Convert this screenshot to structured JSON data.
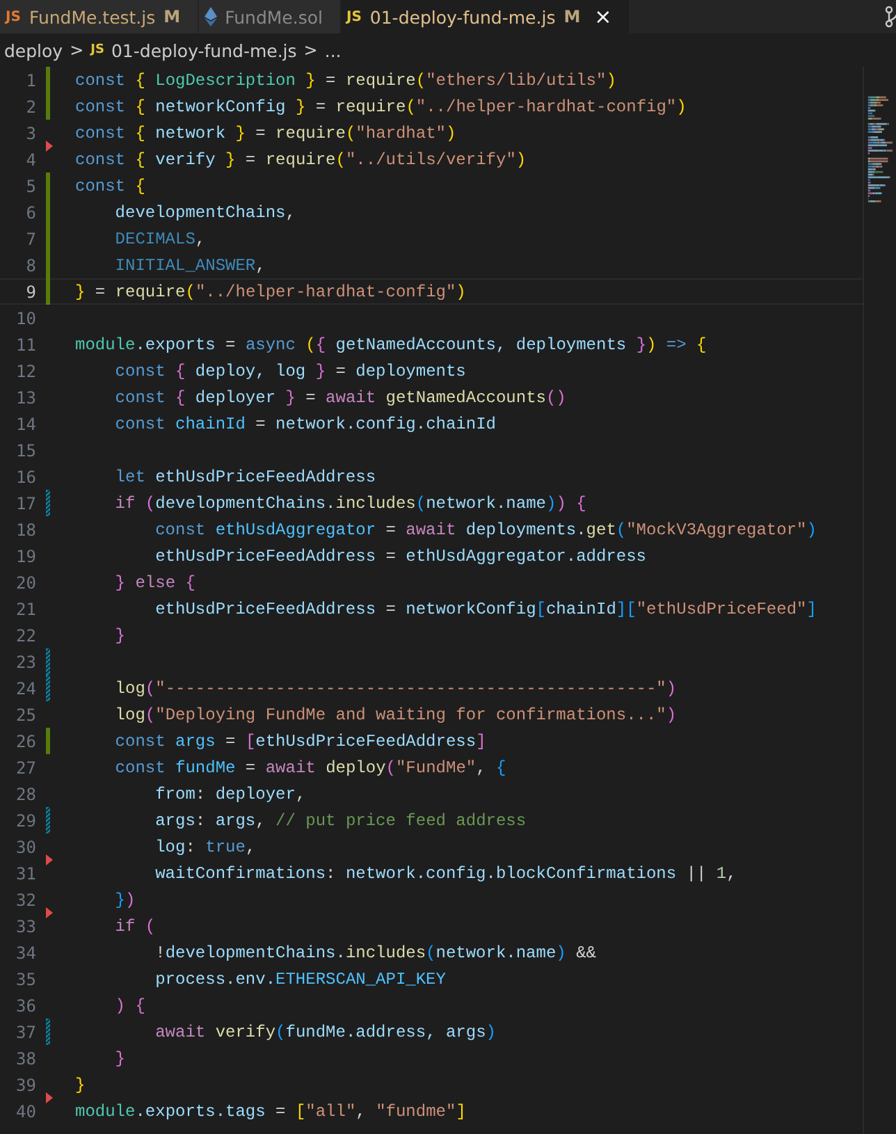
{
  "tabs": [
    {
      "label": "FundMe.test.js",
      "kind": "js",
      "icon_text": "JS",
      "badge": "M",
      "modified": true,
      "selected": false
    },
    {
      "label": "FundMe.sol",
      "kind": "sol",
      "modified": false,
      "selected": false
    },
    {
      "label": "01-deploy-fund-me.js",
      "kind": "js",
      "icon_text": "JS",
      "badge": "M",
      "modified": true,
      "selected": true,
      "close": "×"
    }
  ],
  "breadcrumb": {
    "folder": "deploy",
    "separator": ">",
    "file_badge": "JS",
    "file": "01-deploy-fund-me.js",
    "more": "..."
  },
  "lines": [
    {
      "n": "1",
      "gutter": {
        "kind": "added"
      },
      "current": false,
      "tokens": [
        {
          "text": "const ",
          "kind": "keyword"
        },
        {
          "text": "{",
          "kind": "bracket1"
        },
        {
          "text": " LogDescription ",
          "kind": "type"
        },
        {
          "text": "}",
          "kind": "bracket1"
        },
        {
          "text": " = ",
          "kind": "plain"
        },
        {
          "text": "require",
          "kind": "function"
        },
        {
          "text": "(",
          "kind": "bracket1"
        },
        {
          "text": "\"ethers/lib/utils\"",
          "kind": "string"
        },
        {
          "text": ")",
          "kind": "bracket1"
        }
      ]
    },
    {
      "n": "2",
      "gutter": {
        "kind": "added"
      },
      "current": false,
      "tokens": [
        {
          "text": "const ",
          "kind": "keyword"
        },
        {
          "text": "{",
          "kind": "bracket1"
        },
        {
          "text": " networkConfig ",
          "kind": "variable"
        },
        {
          "text": "}",
          "kind": "bracket1"
        },
        {
          "text": " = ",
          "kind": "plain"
        },
        {
          "text": "require",
          "kind": "function"
        },
        {
          "text": "(",
          "kind": "bracket1"
        },
        {
          "text": "\"../helper-hardhat-config\"",
          "kind": "string"
        },
        {
          "text": ")",
          "kind": "bracket1"
        }
      ]
    },
    {
      "n": "3",
      "current": false,
      "tokens": [
        {
          "text": "const ",
          "kind": "keyword"
        },
        {
          "text": "{",
          "kind": "bracket1"
        },
        {
          "text": " network ",
          "kind": "variable"
        },
        {
          "text": "}",
          "kind": "bracket1"
        },
        {
          "text": " = ",
          "kind": "plain"
        },
        {
          "text": "require",
          "kind": "function"
        },
        {
          "text": "(",
          "kind": "bracket1"
        },
        {
          "text": "\"hardhat\"",
          "kind": "string"
        },
        {
          "text": ")",
          "kind": "bracket1"
        }
      ]
    },
    {
      "n": "4",
      "gutter": {
        "kind": "deleted"
      },
      "current": false,
      "tokens": [
        {
          "text": "const ",
          "kind": "keyword"
        },
        {
          "text": "{",
          "kind": "bracket1"
        },
        {
          "text": " verify ",
          "kind": "variable"
        },
        {
          "text": "}",
          "kind": "bracket1"
        },
        {
          "text": " = ",
          "kind": "plain"
        },
        {
          "text": "require",
          "kind": "function"
        },
        {
          "text": "(",
          "kind": "bracket1"
        },
        {
          "text": "\"../utils/verify\"",
          "kind": "string"
        },
        {
          "text": ")",
          "kind": "bracket1"
        }
      ]
    },
    {
      "n": "5",
      "gutter": {
        "kind": "added"
      },
      "current": false,
      "tokens": [
        {
          "text": "const ",
          "kind": "keyword"
        },
        {
          "text": "{",
          "kind": "bracket1"
        }
      ]
    },
    {
      "n": "6",
      "gutter": {
        "kind": "added"
      },
      "current": false,
      "tokens": [
        {
          "text": "    developmentChains",
          "kind": "variable"
        },
        {
          "text": ",",
          "kind": "plain"
        }
      ]
    },
    {
      "n": "7",
      "gutter": {
        "kind": "added"
      },
      "current": false,
      "tokens": [
        {
          "text": "    DECIMALS",
          "kind": "dimconstant"
        },
        {
          "text": ",",
          "kind": "plain"
        }
      ]
    },
    {
      "n": "8",
      "gutter": {
        "kind": "added"
      },
      "current": false,
      "tokens": [
        {
          "text": "    INITIAL_ANSWER",
          "kind": "dimconstant"
        },
        {
          "text": ",",
          "kind": "plain"
        }
      ]
    },
    {
      "n": "9",
      "gutter": {
        "kind": "added"
      },
      "current": true,
      "tokens": [
        {
          "text": "}",
          "kind": "bracket1"
        },
        {
          "text": " = ",
          "kind": "plain"
        },
        {
          "text": "require",
          "kind": "function"
        },
        {
          "text": "(",
          "kind": "bracket1"
        },
        {
          "text": "\"../helper-hardhat-config\"",
          "kind": "string"
        },
        {
          "text": ")",
          "kind": "bracket1"
        }
      ]
    },
    {
      "n": "10",
      "current": false
    },
    {
      "n": "11",
      "current": false,
      "tokens": [
        {
          "text": "module",
          "kind": "type"
        },
        {
          "text": ".exports",
          "kind": "variable"
        },
        {
          "text": " = ",
          "kind": "plain"
        },
        {
          "text": "async ",
          "kind": "keyword"
        },
        {
          "text": "(",
          "kind": "bracket1"
        },
        {
          "text": "{",
          "kind": "bracket2"
        },
        {
          "text": " getNamedAccounts, deployments ",
          "kind": "variable"
        },
        {
          "text": "}",
          "kind": "bracket2"
        },
        {
          "text": ")",
          "kind": "bracket1"
        },
        {
          "text": " => ",
          "kind": "keyword"
        },
        {
          "text": "{",
          "kind": "bracket1"
        }
      ]
    },
    {
      "n": "12",
      "current": false,
      "tokens": [
        {
          "text": "    const ",
          "kind": "keyword"
        },
        {
          "text": "{",
          "kind": "bracket2"
        },
        {
          "text": " deploy, log ",
          "kind": "variable"
        },
        {
          "text": "}",
          "kind": "bracket2"
        },
        {
          "text": " = ",
          "kind": "plain"
        },
        {
          "text": "deployments",
          "kind": "variable"
        }
      ]
    },
    {
      "n": "13",
      "current": false,
      "tokens": [
        {
          "text": "    const ",
          "kind": "keyword"
        },
        {
          "text": "{",
          "kind": "bracket2"
        },
        {
          "text": " deployer ",
          "kind": "variable"
        },
        {
          "text": "}",
          "kind": "bracket2"
        },
        {
          "text": " = ",
          "kind": "plain"
        },
        {
          "text": "await ",
          "kind": "control"
        },
        {
          "text": "getNamedAccounts",
          "kind": "function"
        },
        {
          "text": "()",
          "kind": "bracket2"
        }
      ]
    },
    {
      "n": "14",
      "current": false,
      "tokens": [
        {
          "text": "    const ",
          "kind": "keyword"
        },
        {
          "text": "chainId",
          "kind": "constant"
        },
        {
          "text": " = ",
          "kind": "plain"
        },
        {
          "text": "network.config.chainId",
          "kind": "variable"
        }
      ]
    },
    {
      "n": "15",
      "current": false
    },
    {
      "n": "16",
      "current": false,
      "tokens": [
        {
          "text": "    let ",
          "kind": "keyword"
        },
        {
          "text": "ethUsdPriceFeedAddress",
          "kind": "variable"
        }
      ]
    },
    {
      "n": "17",
      "gutter": {
        "kind": "modified"
      },
      "current": false,
      "tokens": [
        {
          "text": "    if ",
          "kind": "control"
        },
        {
          "text": "(",
          "kind": "bracket2"
        },
        {
          "text": "developmentChains.",
          "kind": "variable"
        },
        {
          "text": "includes",
          "kind": "function"
        },
        {
          "text": "(",
          "kind": "bracket3"
        },
        {
          "text": "network.name",
          "kind": "variable"
        },
        {
          "text": ")",
          "kind": "bracket3"
        },
        {
          "text": ")",
          "kind": "bracket2"
        },
        {
          "text": " {",
          "kind": "bracket2"
        }
      ]
    },
    {
      "n": "18",
      "current": false,
      "tokens": [
        {
          "text": "        const ",
          "kind": "keyword"
        },
        {
          "text": "ethUsdAggregator",
          "kind": "constant"
        },
        {
          "text": " = ",
          "kind": "plain"
        },
        {
          "text": "await ",
          "kind": "control"
        },
        {
          "text": "deployments.",
          "kind": "variable"
        },
        {
          "text": "get",
          "kind": "function"
        },
        {
          "text": "(",
          "kind": "bracket3"
        },
        {
          "text": "\"MockV3Aggregator\"",
          "kind": "string"
        },
        {
          "text": ")",
          "kind": "bracket3"
        }
      ]
    },
    {
      "n": "19",
      "current": false,
      "tokens": [
        {
          "text": "        ethUsdPriceFeedAddress",
          "kind": "variable"
        },
        {
          "text": " = ",
          "kind": "plain"
        },
        {
          "text": "ethUsdAggregator.address",
          "kind": "variable"
        }
      ]
    },
    {
      "n": "20",
      "current": false,
      "tokens": [
        {
          "text": "    }",
          "kind": "bracket2"
        },
        {
          "text": " else ",
          "kind": "control"
        },
        {
          "text": "{",
          "kind": "bracket2"
        }
      ]
    },
    {
      "n": "21",
      "current": false,
      "tokens": [
        {
          "text": "        ethUsdPriceFeedAddress",
          "kind": "variable"
        },
        {
          "text": " = ",
          "kind": "plain"
        },
        {
          "text": "networkConfig",
          "kind": "variable"
        },
        {
          "text": "[",
          "kind": "bracket3"
        },
        {
          "text": "chainId",
          "kind": "variable"
        },
        {
          "text": "]",
          "kind": "bracket3"
        },
        {
          "text": "[",
          "kind": "bracket3"
        },
        {
          "text": "\"ethUsdPriceFeed\"",
          "kind": "string"
        },
        {
          "text": "]",
          "kind": "bracket3"
        }
      ]
    },
    {
      "n": "22",
      "current": false,
      "tokens": [
        {
          "text": "    }",
          "kind": "bracket2"
        }
      ]
    },
    {
      "n": "23",
      "gutter": {
        "kind": "modified"
      },
      "current": false
    },
    {
      "n": "24",
      "gutter": {
        "kind": "modified"
      },
      "current": false,
      "tokens": [
        {
          "text": "    log",
          "kind": "function"
        },
        {
          "text": "(",
          "kind": "bracket2"
        },
        {
          "text": "\"-------------------------------------------------\"",
          "kind": "string"
        },
        {
          "text": ")",
          "kind": "bracket2"
        }
      ]
    },
    {
      "n": "25",
      "current": false,
      "tokens": [
        {
          "text": "    log",
          "kind": "function"
        },
        {
          "text": "(",
          "kind": "bracket2"
        },
        {
          "text": "\"Deploying FundMe and waiting for confirmations...\"",
          "kind": "string"
        },
        {
          "text": ")",
          "kind": "bracket2"
        }
      ]
    },
    {
      "n": "26",
      "gutter": {
        "kind": "added"
      },
      "current": false,
      "tokens": [
        {
          "text": "    const ",
          "kind": "keyword"
        },
        {
          "text": "args",
          "kind": "constant"
        },
        {
          "text": " = ",
          "kind": "plain"
        },
        {
          "text": "[",
          "kind": "bracket2"
        },
        {
          "text": "ethUsdPriceFeedAddress",
          "kind": "variable"
        },
        {
          "text": "]",
          "kind": "bracket2"
        }
      ]
    },
    {
      "n": "27",
      "current": false,
      "tokens": [
        {
          "text": "    const ",
          "kind": "keyword"
        },
        {
          "text": "fundMe",
          "kind": "constant"
        },
        {
          "text": " = ",
          "kind": "plain"
        },
        {
          "text": "await ",
          "kind": "control"
        },
        {
          "text": "deploy",
          "kind": "function"
        },
        {
          "text": "(",
          "kind": "bracket2"
        },
        {
          "text": "\"FundMe\"",
          "kind": "string"
        },
        {
          "text": ", ",
          "kind": "plain"
        },
        {
          "text": "{",
          "kind": "bracket3"
        }
      ]
    },
    {
      "n": "28",
      "current": false,
      "tokens": [
        {
          "text": "        from",
          "kind": "variable"
        },
        {
          "text": ": ",
          "kind": "plain"
        },
        {
          "text": "deployer",
          "kind": "variable"
        },
        {
          "text": ",",
          "kind": "plain"
        }
      ]
    },
    {
      "n": "29",
      "gutter": {
        "kind": "modified"
      },
      "current": false,
      "tokens": [
        {
          "text": "        args",
          "kind": "variable"
        },
        {
          "text": ": ",
          "kind": "plain"
        },
        {
          "text": "args",
          "kind": "variable"
        },
        {
          "text": ", ",
          "kind": "plain"
        },
        {
          "text": "// put price feed address",
          "kind": "comment"
        }
      ]
    },
    {
      "n": "30",
      "current": false,
      "tokens": [
        {
          "text": "        log",
          "kind": "variable"
        },
        {
          "text": ": ",
          "kind": "plain"
        },
        {
          "text": "true",
          "kind": "keyword"
        },
        {
          "text": ",",
          "kind": "plain"
        }
      ]
    },
    {
      "n": "31",
      "gutter": {
        "kind": "deleted"
      },
      "current": false,
      "tokens": [
        {
          "text": "        waitConfirmations",
          "kind": "variable"
        },
        {
          "text": ": ",
          "kind": "plain"
        },
        {
          "text": "network.config.blockConfirmations",
          "kind": "variable"
        },
        {
          "text": " || ",
          "kind": "plain"
        },
        {
          "text": "1",
          "kind": "number"
        },
        {
          "text": ",",
          "kind": "plain"
        }
      ]
    },
    {
      "n": "32",
      "current": false,
      "tokens": [
        {
          "text": "    }",
          "kind": "bracket3"
        },
        {
          "text": ")",
          "kind": "bracket2"
        }
      ]
    },
    {
      "n": "33",
      "gutter": {
        "kind": "deleted"
      },
      "current": false,
      "tokens": [
        {
          "text": "    if ",
          "kind": "control"
        },
        {
          "text": "(",
          "kind": "bracket2"
        }
      ]
    },
    {
      "n": "34",
      "current": false,
      "tokens": [
        {
          "text": "        !",
          "kind": "plain"
        },
        {
          "text": "developmentChains.",
          "kind": "variable"
        },
        {
          "text": "includes",
          "kind": "function"
        },
        {
          "text": "(",
          "kind": "bracket3"
        },
        {
          "text": "network.name",
          "kind": "variable"
        },
        {
          "text": ")",
          "kind": "bracket3"
        },
        {
          "text": " &&",
          "kind": "plain"
        }
      ]
    },
    {
      "n": "35",
      "current": false,
      "tokens": [
        {
          "text": "        process.env.",
          "kind": "variable"
        },
        {
          "text": "ETHERSCAN_API_KEY",
          "kind": "constant"
        }
      ]
    },
    {
      "n": "36",
      "current": false,
      "tokens": [
        {
          "text": "    )",
          "kind": "bracket2"
        },
        {
          "text": " {",
          "kind": "bracket2"
        }
      ]
    },
    {
      "n": "37",
      "gutter": {
        "kind": "modified"
      },
      "current": false,
      "tokens": [
        {
          "text": "        await ",
          "kind": "control"
        },
        {
          "text": "verify",
          "kind": "function"
        },
        {
          "text": "(",
          "kind": "bracket3"
        },
        {
          "text": "fundMe.address, args",
          "kind": "variable"
        },
        {
          "text": ")",
          "kind": "bracket3"
        }
      ]
    },
    {
      "n": "38",
      "current": false,
      "tokens": [
        {
          "text": "    }",
          "kind": "bracket2"
        }
      ]
    },
    {
      "n": "39",
      "current": false,
      "tokens": [
        {
          "text": "}",
          "kind": "bracket1"
        }
      ]
    },
    {
      "n": "40",
      "gutter": {
        "kind": "deleted"
      },
      "current": false,
      "tokens": [
        {
          "text": "module",
          "kind": "type"
        },
        {
          "text": ".exports.tags",
          "kind": "variable"
        },
        {
          "text": " = ",
          "kind": "plain"
        },
        {
          "text": "[",
          "kind": "bracket1"
        },
        {
          "text": "\"all\"",
          "kind": "string"
        },
        {
          "text": ", ",
          "kind": "plain"
        },
        {
          "text": "\"fundme\"",
          "kind": "string"
        },
        {
          "text": "]",
          "kind": "bracket1"
        }
      ]
    }
  ]
}
